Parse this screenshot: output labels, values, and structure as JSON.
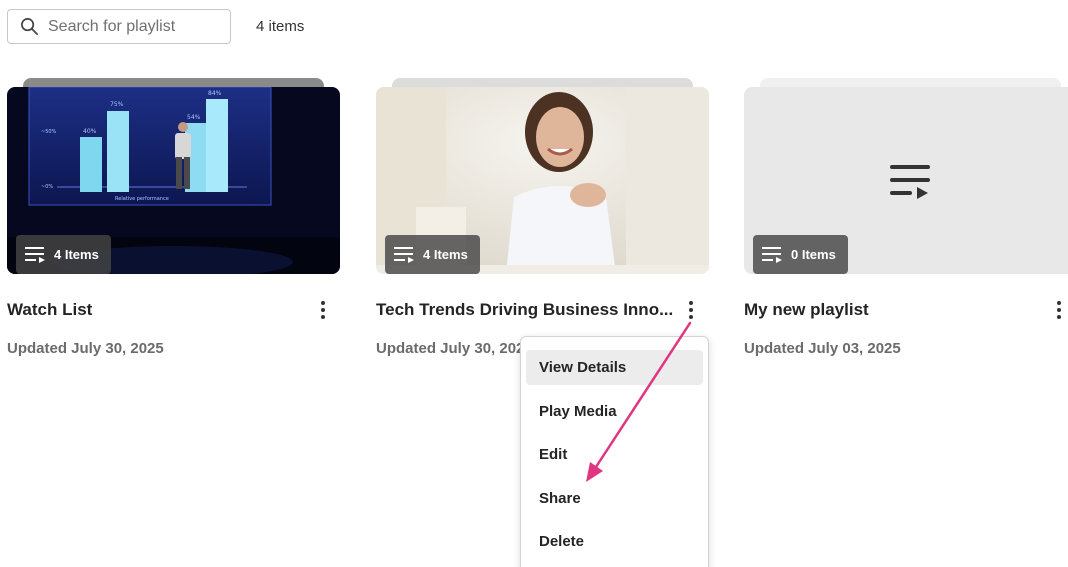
{
  "search": {
    "placeholder": "Search for playlist",
    "value": ""
  },
  "toolbar": {
    "item_count": "4 items"
  },
  "playlists": [
    {
      "title": "Watch List",
      "updated": "Updated July 30, 2025",
      "badge": "4 Items",
      "thumbnail": "presentation-stage-photo"
    },
    {
      "title": "Tech Trends Driving Business Inno...",
      "updated": "Updated July 30, 2025",
      "badge": "4 Items",
      "thumbnail": "smiling-woman-photo"
    },
    {
      "title": "My new playlist",
      "updated": "Updated July 03, 2025",
      "badge": "0 Items",
      "thumbnail": "playlist-icon-placeholder"
    }
  ],
  "context_menu": {
    "items": [
      "View Details",
      "Play Media",
      "Edit",
      "Share",
      "Delete"
    ],
    "highlighted": "View Details"
  },
  "chart_in_thumbnail": {
    "labels": [
      "40%",
      "75%",
      "54%",
      "84%"
    ],
    "axis": [
      "~50%",
      "~0%"
    ],
    "xlabel": "Relative performance"
  },
  "colors": {
    "annotation_arrow": "#e0357f",
    "badge_bg": "#464646",
    "menu_highlight": "#ececec"
  },
  "icons": {
    "search": "search-icon",
    "playlist": "playlist-icon",
    "more": "more-vertical-icon"
  }
}
